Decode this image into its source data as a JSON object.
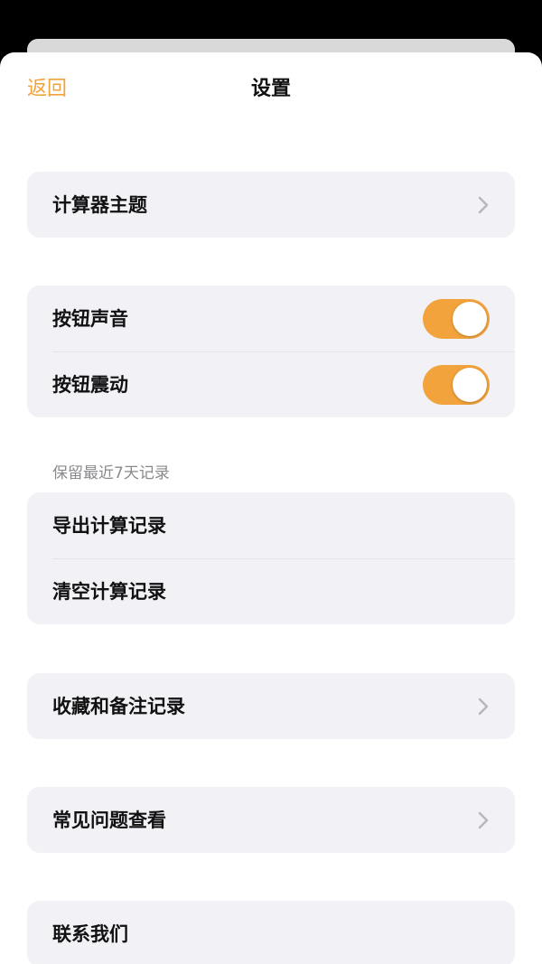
{
  "theme": {
    "accent": "#f3a33b",
    "group_bg": "#f1f1f6",
    "chevron": "#b6b6bc"
  },
  "nav": {
    "back_label": "返回",
    "title": "设置"
  },
  "groups": {
    "theme_group": {
      "items": [
        {
          "label": "计算器主题",
          "accessory": "chevron-right-icon"
        }
      ]
    },
    "feedback_group": {
      "items": [
        {
          "label": "按钮声音",
          "toggle_on": true
        },
        {
          "label": "按钮震动",
          "toggle_on": true
        }
      ]
    },
    "history_group": {
      "note": "保留最近7天记录",
      "items": [
        {
          "label": "导出计算记录"
        },
        {
          "label": "清空计算记录"
        }
      ]
    },
    "favorites_group": {
      "items": [
        {
          "label": "收藏和备注记录",
          "accessory": "chevron-right-icon"
        }
      ]
    },
    "faq_group": {
      "items": [
        {
          "label": "常见问题查看",
          "accessory": "chevron-right-icon"
        }
      ]
    },
    "contact_group": {
      "items": [
        {
          "label": "联系我们"
        }
      ]
    }
  }
}
